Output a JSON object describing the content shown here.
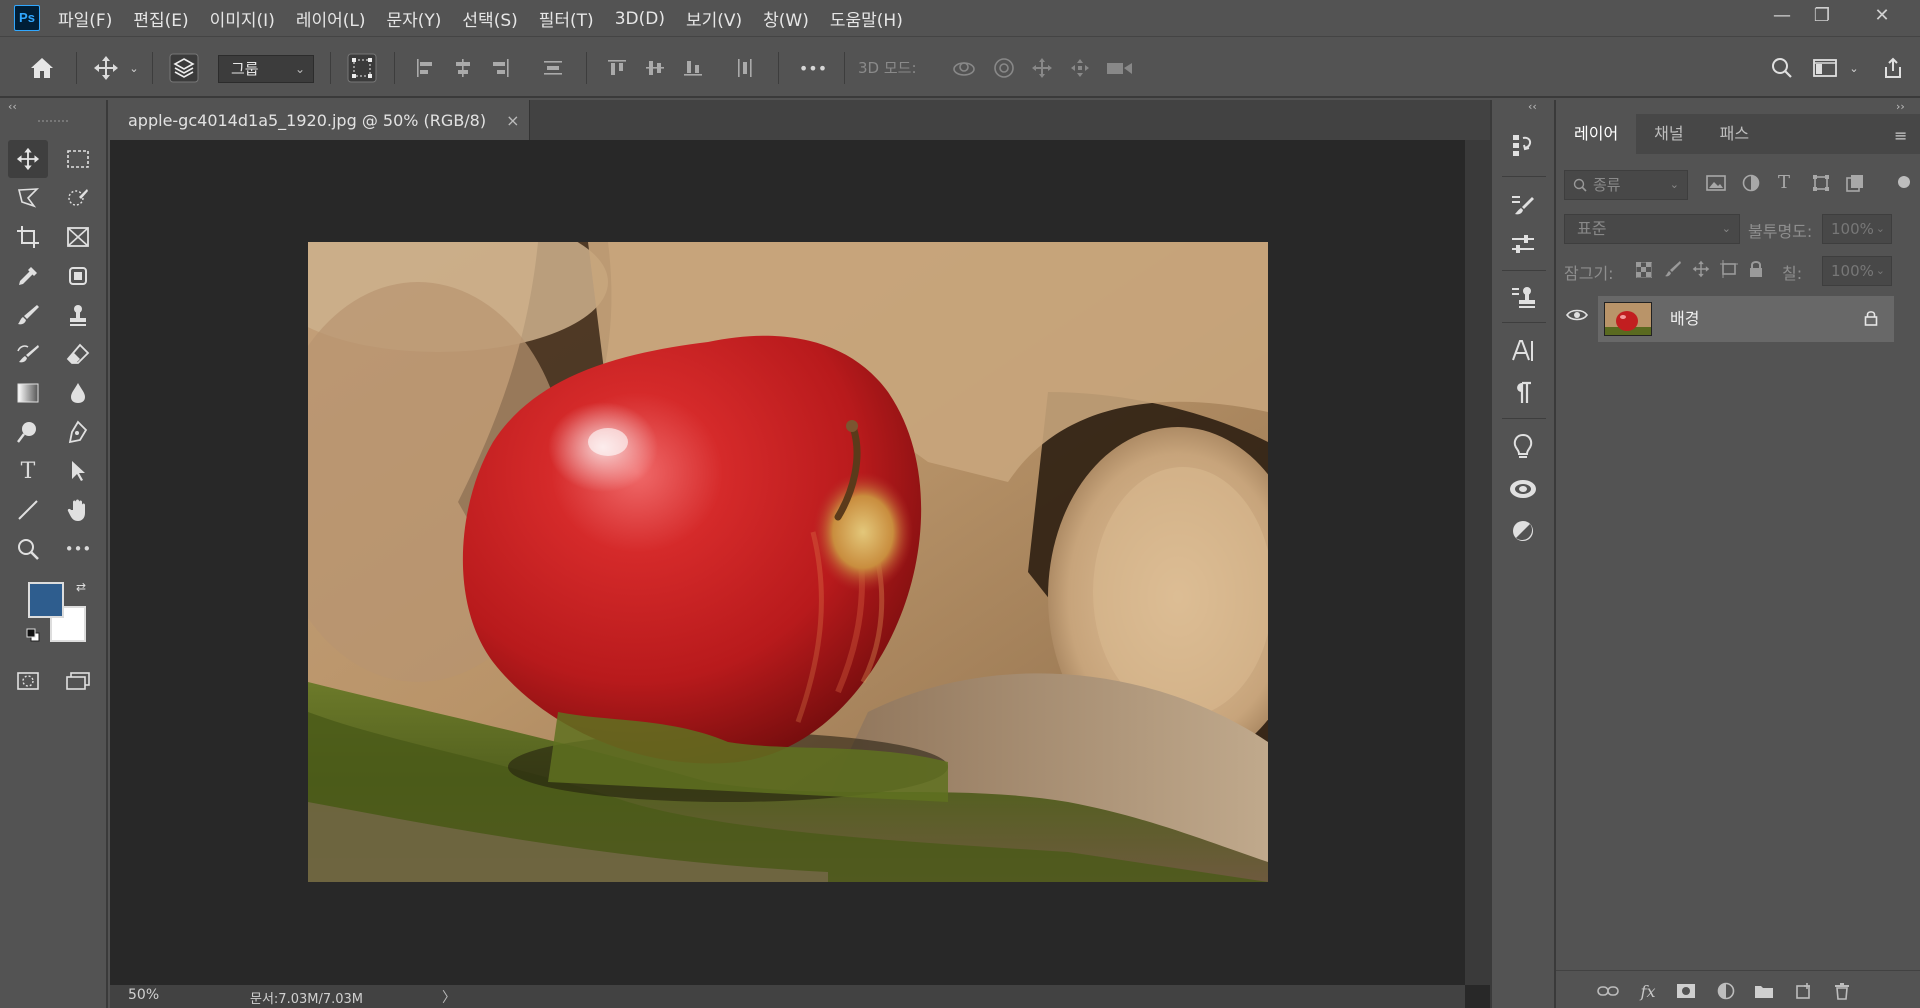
{
  "app": {
    "logo_text": "Ps",
    "menu": [
      "파일(F)",
      "편집(E)",
      "이미지(I)",
      "레이어(L)",
      "문자(Y)",
      "선택(S)",
      "필터(T)",
      "3D(D)",
      "보기(V)",
      "창(W)",
      "도움말(H)"
    ]
  },
  "window_controls": {
    "minimize": "—",
    "restore": "❐",
    "close": "✕"
  },
  "options": {
    "auto_select_value": "그룹",
    "mode3d_label": "3D 모드:",
    "more_label": "•••"
  },
  "toolbar": {
    "foreground_color": "#2e5d8e",
    "background_color": "#ffffff",
    "collapse_glyph": "‹‹"
  },
  "document": {
    "tab_title": "apple-gc4014d1a5_1920.jpg @ 50% (RGB/8)",
    "tab_close": "×",
    "zoom": "50%",
    "doc_size": "문서:7.03M/7.03M",
    "status_arrow": "〉"
  },
  "panel_strip": {
    "collapse_glyph": "‹‹"
  },
  "layers_panel": {
    "collapse_glyph": "››",
    "tabs": [
      "레이어",
      "채널",
      "패스"
    ],
    "active_tab": 0,
    "kind_filter_placeholder": "종류",
    "blend_mode": "표준",
    "opacity_label": "불투명도:",
    "opacity_value": "100%",
    "lock_label": "잠그기:",
    "fill_label": "칠:",
    "fill_value": "100%",
    "layers": [
      {
        "name": "배경",
        "visible": true,
        "locked": true
      }
    ]
  },
  "colors": {
    "ui_background": "#535353",
    "canvas_background": "#282828",
    "accent": "#31a8ff"
  }
}
